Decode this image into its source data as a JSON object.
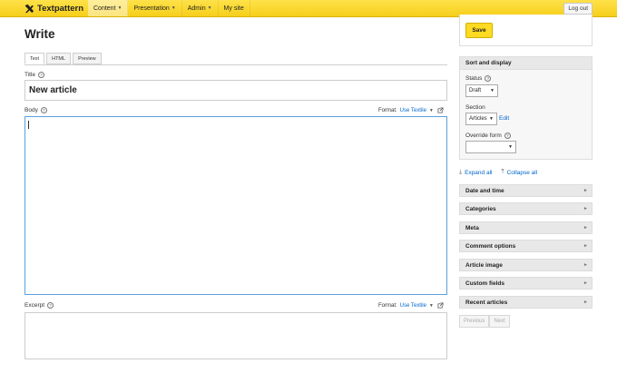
{
  "brand": "Textpattern",
  "nav": [
    {
      "label": "Content",
      "has_menu": true,
      "active": true
    },
    {
      "label": "Presentation",
      "has_menu": true,
      "active": false
    },
    {
      "label": "Admin",
      "has_menu": true,
      "active": false
    },
    {
      "label": "My site",
      "has_menu": false,
      "active": false
    }
  ],
  "logout_label": "Log out",
  "page_title": "Write",
  "tabs": [
    "Text",
    "HTML",
    "Preview"
  ],
  "title_field": {
    "label": "Title",
    "value": "New article"
  },
  "body_field": {
    "label": "Body",
    "format_label": "Format:",
    "format_value": "Use Textile"
  },
  "excerpt_field": {
    "label": "Excerpt",
    "format_label": "Format:",
    "format_value": "Use Textile"
  },
  "save_label": "Save",
  "sort_display": {
    "title": "Sort and display",
    "status_label": "Status",
    "status_value": "Draft",
    "section_label": "Section",
    "section_value": "Articles",
    "edit_label": "Edit",
    "override_label": "Override form",
    "override_value": ""
  },
  "expand_all": "Expand all",
  "collapse_all": "Collapse all",
  "panels": [
    "Date and time",
    "Categories",
    "Meta",
    "Comment options",
    "Article image",
    "Custom fields",
    "Recent articles"
  ],
  "pager": {
    "previous": "Previous",
    "next": "Next"
  },
  "colors": {
    "accent": "#ffda22",
    "link": "#0066cc",
    "focus": "#5aa0e0"
  }
}
